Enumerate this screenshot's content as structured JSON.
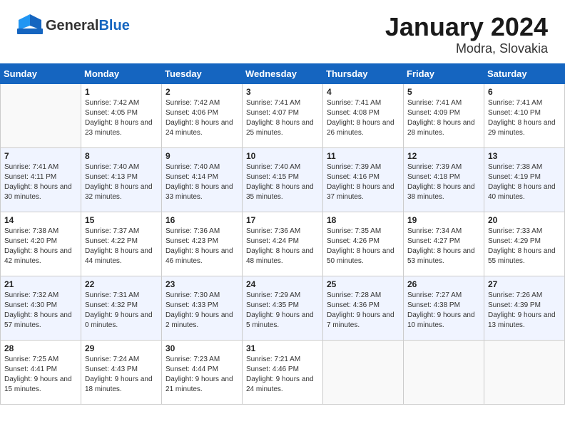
{
  "header": {
    "logo_general": "General",
    "logo_blue": "Blue",
    "title": "January 2024",
    "subtitle": "Modra, Slovakia"
  },
  "days_of_week": [
    "Sunday",
    "Monday",
    "Tuesday",
    "Wednesday",
    "Thursday",
    "Friday",
    "Saturday"
  ],
  "weeks": [
    [
      {
        "day": "",
        "sunrise": "",
        "sunset": "",
        "daylight": ""
      },
      {
        "day": "1",
        "sunrise": "Sunrise: 7:42 AM",
        "sunset": "Sunset: 4:05 PM",
        "daylight": "Daylight: 8 hours and 23 minutes."
      },
      {
        "day": "2",
        "sunrise": "Sunrise: 7:42 AM",
        "sunset": "Sunset: 4:06 PM",
        "daylight": "Daylight: 8 hours and 24 minutes."
      },
      {
        "day": "3",
        "sunrise": "Sunrise: 7:41 AM",
        "sunset": "Sunset: 4:07 PM",
        "daylight": "Daylight: 8 hours and 25 minutes."
      },
      {
        "day": "4",
        "sunrise": "Sunrise: 7:41 AM",
        "sunset": "Sunset: 4:08 PM",
        "daylight": "Daylight: 8 hours and 26 minutes."
      },
      {
        "day": "5",
        "sunrise": "Sunrise: 7:41 AM",
        "sunset": "Sunset: 4:09 PM",
        "daylight": "Daylight: 8 hours and 28 minutes."
      },
      {
        "day": "6",
        "sunrise": "Sunrise: 7:41 AM",
        "sunset": "Sunset: 4:10 PM",
        "daylight": "Daylight: 8 hours and 29 minutes."
      }
    ],
    [
      {
        "day": "7",
        "sunrise": "Sunrise: 7:41 AM",
        "sunset": "Sunset: 4:11 PM",
        "daylight": "Daylight: 8 hours and 30 minutes."
      },
      {
        "day": "8",
        "sunrise": "Sunrise: 7:40 AM",
        "sunset": "Sunset: 4:13 PM",
        "daylight": "Daylight: 8 hours and 32 minutes."
      },
      {
        "day": "9",
        "sunrise": "Sunrise: 7:40 AM",
        "sunset": "Sunset: 4:14 PM",
        "daylight": "Daylight: 8 hours and 33 minutes."
      },
      {
        "day": "10",
        "sunrise": "Sunrise: 7:40 AM",
        "sunset": "Sunset: 4:15 PM",
        "daylight": "Daylight: 8 hours and 35 minutes."
      },
      {
        "day": "11",
        "sunrise": "Sunrise: 7:39 AM",
        "sunset": "Sunset: 4:16 PM",
        "daylight": "Daylight: 8 hours and 37 minutes."
      },
      {
        "day": "12",
        "sunrise": "Sunrise: 7:39 AM",
        "sunset": "Sunset: 4:18 PM",
        "daylight": "Daylight: 8 hours and 38 minutes."
      },
      {
        "day": "13",
        "sunrise": "Sunrise: 7:38 AM",
        "sunset": "Sunset: 4:19 PM",
        "daylight": "Daylight: 8 hours and 40 minutes."
      }
    ],
    [
      {
        "day": "14",
        "sunrise": "Sunrise: 7:38 AM",
        "sunset": "Sunset: 4:20 PM",
        "daylight": "Daylight: 8 hours and 42 minutes."
      },
      {
        "day": "15",
        "sunrise": "Sunrise: 7:37 AM",
        "sunset": "Sunset: 4:22 PM",
        "daylight": "Daylight: 8 hours and 44 minutes."
      },
      {
        "day": "16",
        "sunrise": "Sunrise: 7:36 AM",
        "sunset": "Sunset: 4:23 PM",
        "daylight": "Daylight: 8 hours and 46 minutes."
      },
      {
        "day": "17",
        "sunrise": "Sunrise: 7:36 AM",
        "sunset": "Sunset: 4:24 PM",
        "daylight": "Daylight: 8 hours and 48 minutes."
      },
      {
        "day": "18",
        "sunrise": "Sunrise: 7:35 AM",
        "sunset": "Sunset: 4:26 PM",
        "daylight": "Daylight: 8 hours and 50 minutes."
      },
      {
        "day": "19",
        "sunrise": "Sunrise: 7:34 AM",
        "sunset": "Sunset: 4:27 PM",
        "daylight": "Daylight: 8 hours and 53 minutes."
      },
      {
        "day": "20",
        "sunrise": "Sunrise: 7:33 AM",
        "sunset": "Sunset: 4:29 PM",
        "daylight": "Daylight: 8 hours and 55 minutes."
      }
    ],
    [
      {
        "day": "21",
        "sunrise": "Sunrise: 7:32 AM",
        "sunset": "Sunset: 4:30 PM",
        "daylight": "Daylight: 8 hours and 57 minutes."
      },
      {
        "day": "22",
        "sunrise": "Sunrise: 7:31 AM",
        "sunset": "Sunset: 4:32 PM",
        "daylight": "Daylight: 9 hours and 0 minutes."
      },
      {
        "day": "23",
        "sunrise": "Sunrise: 7:30 AM",
        "sunset": "Sunset: 4:33 PM",
        "daylight": "Daylight: 9 hours and 2 minutes."
      },
      {
        "day": "24",
        "sunrise": "Sunrise: 7:29 AM",
        "sunset": "Sunset: 4:35 PM",
        "daylight": "Daylight: 9 hours and 5 minutes."
      },
      {
        "day": "25",
        "sunrise": "Sunrise: 7:28 AM",
        "sunset": "Sunset: 4:36 PM",
        "daylight": "Daylight: 9 hours and 7 minutes."
      },
      {
        "day": "26",
        "sunrise": "Sunrise: 7:27 AM",
        "sunset": "Sunset: 4:38 PM",
        "daylight": "Daylight: 9 hours and 10 minutes."
      },
      {
        "day": "27",
        "sunrise": "Sunrise: 7:26 AM",
        "sunset": "Sunset: 4:39 PM",
        "daylight": "Daylight: 9 hours and 13 minutes."
      }
    ],
    [
      {
        "day": "28",
        "sunrise": "Sunrise: 7:25 AM",
        "sunset": "Sunset: 4:41 PM",
        "daylight": "Daylight: 9 hours and 15 minutes."
      },
      {
        "day": "29",
        "sunrise": "Sunrise: 7:24 AM",
        "sunset": "Sunset: 4:43 PM",
        "daylight": "Daylight: 9 hours and 18 minutes."
      },
      {
        "day": "30",
        "sunrise": "Sunrise: 7:23 AM",
        "sunset": "Sunset: 4:44 PM",
        "daylight": "Daylight: 9 hours and 21 minutes."
      },
      {
        "day": "31",
        "sunrise": "Sunrise: 7:21 AM",
        "sunset": "Sunset: 4:46 PM",
        "daylight": "Daylight: 9 hours and 24 minutes."
      },
      {
        "day": "",
        "sunrise": "",
        "sunset": "",
        "daylight": ""
      },
      {
        "day": "",
        "sunrise": "",
        "sunset": "",
        "daylight": ""
      },
      {
        "day": "",
        "sunrise": "",
        "sunset": "",
        "daylight": ""
      }
    ]
  ]
}
